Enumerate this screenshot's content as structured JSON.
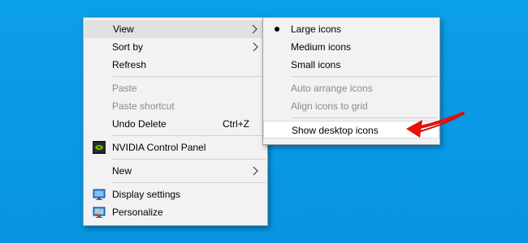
{
  "context_menu": {
    "items": [
      {
        "label": "View",
        "has_submenu": true
      },
      {
        "label": "Sort by",
        "has_submenu": true
      },
      {
        "label": "Refresh"
      },
      {
        "label": "Paste",
        "disabled": true
      },
      {
        "label": "Paste shortcut",
        "disabled": true
      },
      {
        "label": "Undo Delete",
        "shortcut": "Ctrl+Z"
      },
      {
        "label": "NVIDIA Control Panel",
        "icon": "nvidia-icon"
      },
      {
        "label": "New",
        "has_submenu": true
      },
      {
        "label": "Display settings",
        "icon": "display-settings-icon"
      },
      {
        "label": "Personalize",
        "icon": "personalize-icon"
      }
    ]
  },
  "view_submenu": {
    "items": [
      {
        "label": "Large icons",
        "checked": true
      },
      {
        "label": "Medium icons"
      },
      {
        "label": "Small icons"
      },
      {
        "label": "Auto arrange icons",
        "disabled": true
      },
      {
        "label": "Align icons to grid",
        "disabled": true
      },
      {
        "label": "Show desktop icons"
      }
    ]
  },
  "annotation": {
    "icon": "red-arrow-pointer",
    "color": "#e8120c"
  },
  "colors": {
    "desktop_background": "#0a99e6",
    "menu_background": "#f2f2f2",
    "disabled_text": "#8a8a8a"
  }
}
